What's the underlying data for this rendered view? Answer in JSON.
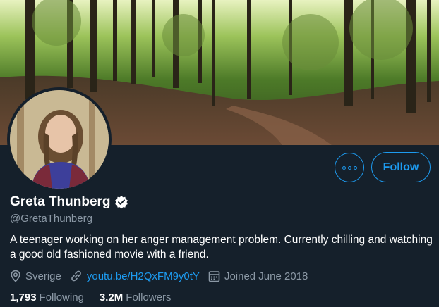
{
  "profile": {
    "name": "Greta Thunberg",
    "handle": "@GretaThunberg",
    "bio": "A teenager working on her anger management problem. Currently chilling and watching a good old fashioned movie with a friend.",
    "location": "Sverige",
    "link": "youtu.be/H2QxFM9y0tY",
    "joined": "Joined June 2018",
    "verified": true
  },
  "actions": {
    "follow_label": "Follow",
    "more_icon": "more-icon"
  },
  "stats": {
    "following_count": "1,793",
    "following_label": "Following",
    "followers_count": "3.2M",
    "followers_label": "Followers"
  },
  "icons": {
    "location": "location-pin-icon",
    "link": "link-icon",
    "calendar": "calendar-icon",
    "verified": "verified-badge-icon"
  },
  "colors": {
    "background": "#15202b",
    "accent": "#1d9bf0",
    "secondary_text": "#8b98a5"
  }
}
